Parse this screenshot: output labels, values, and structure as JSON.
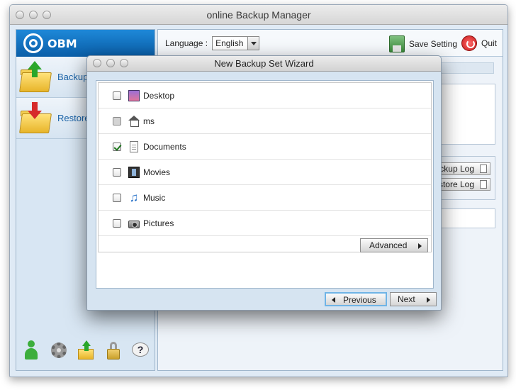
{
  "window": {
    "title": "online Backup Manager"
  },
  "sidebar": {
    "logo": "OBM",
    "items": [
      {
        "label": "Backup",
        "icon": "backup-folder-icon"
      },
      {
        "label": "Restore",
        "icon": "restore-folder-icon"
      }
    ],
    "bottom_icons": [
      "user-icon",
      "settings-gear-icon",
      "upload-folder-icon",
      "lock-icon",
      "help-icon"
    ]
  },
  "toolbar": {
    "language_label": "Language :",
    "language_value": "English",
    "save_label": "Save Setting",
    "quit_label": "Quit"
  },
  "logs": {
    "backup_log": "Backup Log",
    "restore_log": "Restore Log"
  },
  "dialog": {
    "title": "New Backup Set Wizard",
    "items": [
      {
        "label": "Desktop",
        "checked": false,
        "icon": "desktop-icon"
      },
      {
        "label": "ms",
        "checked": false,
        "icon": "home-icon",
        "partial": true
      },
      {
        "label": "Documents",
        "checked": true,
        "icon": "document-icon"
      },
      {
        "label": "Movies",
        "checked": false,
        "icon": "film-icon"
      },
      {
        "label": "Music",
        "checked": false,
        "icon": "music-note-icon"
      },
      {
        "label": "Pictures",
        "checked": false,
        "icon": "camera-icon"
      }
    ],
    "advanced_label": "Advanced",
    "previous_label": "Previous",
    "next_label": "Next"
  }
}
